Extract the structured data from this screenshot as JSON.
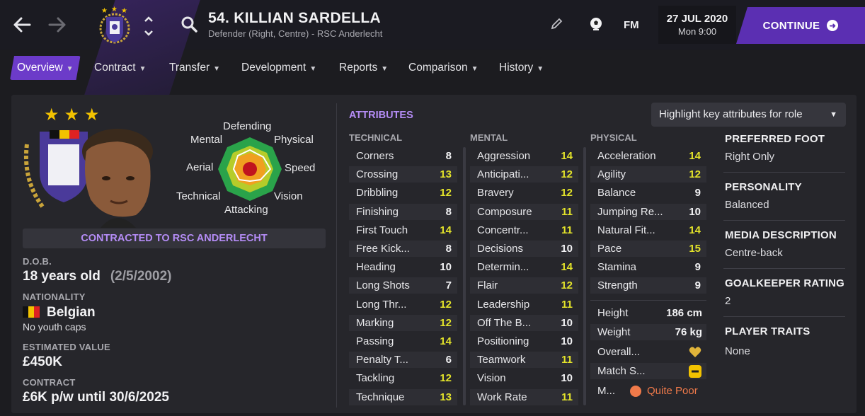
{
  "header": {
    "player_title": "54. KILLIAN SARDELLA",
    "player_subtitle": "Defender (Right, Centre) - RSC Anderlecht",
    "date": "27 JUL 2020",
    "time": "Mon 9:00",
    "fm_label": "FM",
    "continue_label": "CONTINUE"
  },
  "tabs": [
    {
      "label": "Overview"
    },
    {
      "label": "Contract"
    },
    {
      "label": "Transfer"
    },
    {
      "label": "Development"
    },
    {
      "label": "Reports"
    },
    {
      "label": "Comparison"
    },
    {
      "label": "History"
    }
  ],
  "profile": {
    "radar_labels": {
      "top": "Defending",
      "mental": "Mental",
      "physical": "Physical",
      "aerial": "Aerial",
      "speed": "Speed",
      "technical": "Technical",
      "vision": "Vision",
      "attacking": "Attacking"
    },
    "contracted_to": "CONTRACTED TO RSC ANDERLECHT",
    "dob_label": "D.O.B.",
    "age": "18 years old",
    "dob": "(2/5/2002)",
    "nationality_label": "NATIONALITY",
    "nationality": "Belgian",
    "youth_caps": "No youth caps",
    "value_label": "ESTIMATED VALUE",
    "value": "£450K",
    "contract_label": "CONTRACT",
    "contract": "£6K p/w until 30/6/2025"
  },
  "attributes": {
    "title": "ATTRIBUTES",
    "highlight_label": "Highlight key attributes for role",
    "technical_header": "TECHNICAL",
    "mental_header": "MENTAL",
    "physical_header": "PHYSICAL",
    "technical": [
      {
        "name": "Corners",
        "value": "8"
      },
      {
        "name": "Crossing",
        "value": "13"
      },
      {
        "name": "Dribbling",
        "value": "12"
      },
      {
        "name": "Finishing",
        "value": "8"
      },
      {
        "name": "First Touch",
        "value": "14"
      },
      {
        "name": "Free Kick...",
        "value": "8"
      },
      {
        "name": "Heading",
        "value": "10"
      },
      {
        "name": "Long Shots",
        "value": "7"
      },
      {
        "name": "Long Thr...",
        "value": "12"
      },
      {
        "name": "Marking",
        "value": "12"
      },
      {
        "name": "Passing",
        "value": "14"
      },
      {
        "name": "Penalty T...",
        "value": "6"
      },
      {
        "name": "Tackling",
        "value": "12"
      },
      {
        "name": "Technique",
        "value": "13"
      }
    ],
    "mental": [
      {
        "name": "Aggression",
        "value": "14"
      },
      {
        "name": "Anticipati...",
        "value": "12"
      },
      {
        "name": "Bravery",
        "value": "12"
      },
      {
        "name": "Composure",
        "value": "11"
      },
      {
        "name": "Concentr...",
        "value": "11"
      },
      {
        "name": "Decisions",
        "value": "10"
      },
      {
        "name": "Determin...",
        "value": "14"
      },
      {
        "name": "Flair",
        "value": "12"
      },
      {
        "name": "Leadership",
        "value": "11"
      },
      {
        "name": "Off The B...",
        "value": "10"
      },
      {
        "name": "Positioning",
        "value": "10"
      },
      {
        "name": "Teamwork",
        "value": "11"
      },
      {
        "name": "Vision",
        "value": "10"
      },
      {
        "name": "Work Rate",
        "value": "11"
      }
    ],
    "physical": [
      {
        "name": "Acceleration",
        "value": "14"
      },
      {
        "name": "Agility",
        "value": "12"
      },
      {
        "name": "Balance",
        "value": "9"
      },
      {
        "name": "Jumping Re...",
        "value": "10"
      },
      {
        "name": "Natural Fit...",
        "value": "14"
      },
      {
        "name": "Pace",
        "value": "15"
      },
      {
        "name": "Stamina",
        "value": "9"
      },
      {
        "name": "Strength",
        "value": "9"
      }
    ],
    "extras": {
      "height_label": "Height",
      "height": "186 cm",
      "weight_label": "Weight",
      "weight": "76 kg",
      "overall_label": "Overall...",
      "match_label": "Match S...",
      "morale_label": "M...",
      "morale": "Quite Poor"
    }
  },
  "right": {
    "foot_label": "PREFERRED FOOT",
    "foot": "Right Only",
    "personality_label": "PERSONALITY",
    "personality": "Balanced",
    "media_label": "MEDIA DESCRIPTION",
    "media": "Centre-back",
    "gk_label": "GOALKEEPER RATING",
    "gk": "2",
    "traits_label": "PLAYER TRAITS",
    "traits": "None"
  },
  "colors": {
    "accent": "#6c3bc9",
    "attr_title": "#b48cf5",
    "high_value": "#e3e32a",
    "morale": "#f07a4a"
  }
}
